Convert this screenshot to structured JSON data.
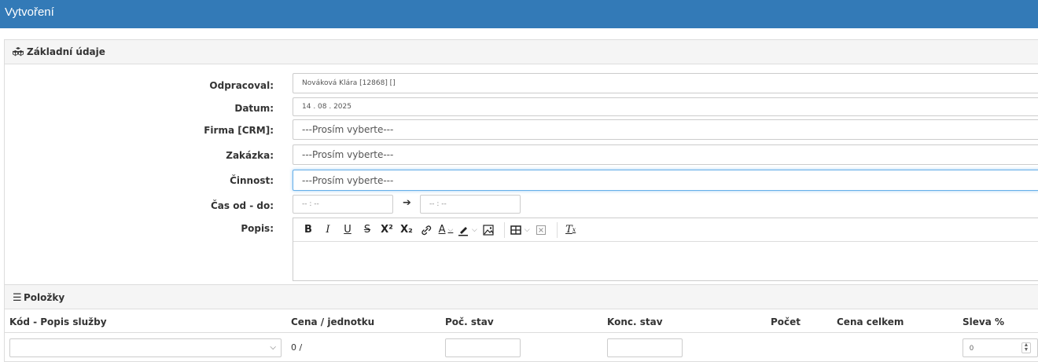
{
  "window": {
    "title": "Vytvoření"
  },
  "section_basic": {
    "title": "Základní údaje",
    "icon": "cubes-icon",
    "fields": {
      "worker": {
        "label": "Odpracoval:",
        "value": "Nováková Klára [12868] []"
      },
      "date": {
        "label": "Datum:",
        "value": "14 . 08 . 2025"
      },
      "company": {
        "label": "Firma [CRM]:",
        "value": "---Prosím vyberte---"
      },
      "order": {
        "label": "Zakázka:",
        "value": "---Prosím vyberte---"
      },
      "activity": {
        "label": "Činnost:",
        "value": "---Prosím vyberte---"
      },
      "time": {
        "label": "Čas od - do:",
        "from": "-- : --",
        "to": "-- : --"
      },
      "description": {
        "label": "Popis:",
        "value": ""
      }
    },
    "editor_toolbar": {
      "bold": "B",
      "italic": "I",
      "underline": "U",
      "strike": "S",
      "superscript": "X²",
      "subscript": "X₂",
      "link": "🔗",
      "text_color": "A",
      "highlight": "✎",
      "image": "▣",
      "table": "⊞",
      "embed": "⊠",
      "clear_format": "Tx"
    }
  },
  "section_items": {
    "title": "Položky",
    "columns": [
      "Kód - Popis služby",
      "Cena / jednotku",
      "Poč. stav",
      "Konc. stav",
      "Počet",
      "Cena celkem",
      "Sleva %"
    ],
    "row": {
      "service": "",
      "price": "0 /",
      "start_state": "",
      "end_state": "",
      "count": "",
      "total": "",
      "discount": "0"
    }
  },
  "colors": {
    "header_bg": "#337ab7",
    "panel_heading_bg": "#f5f5f5",
    "focus_border": "#66afe9"
  }
}
